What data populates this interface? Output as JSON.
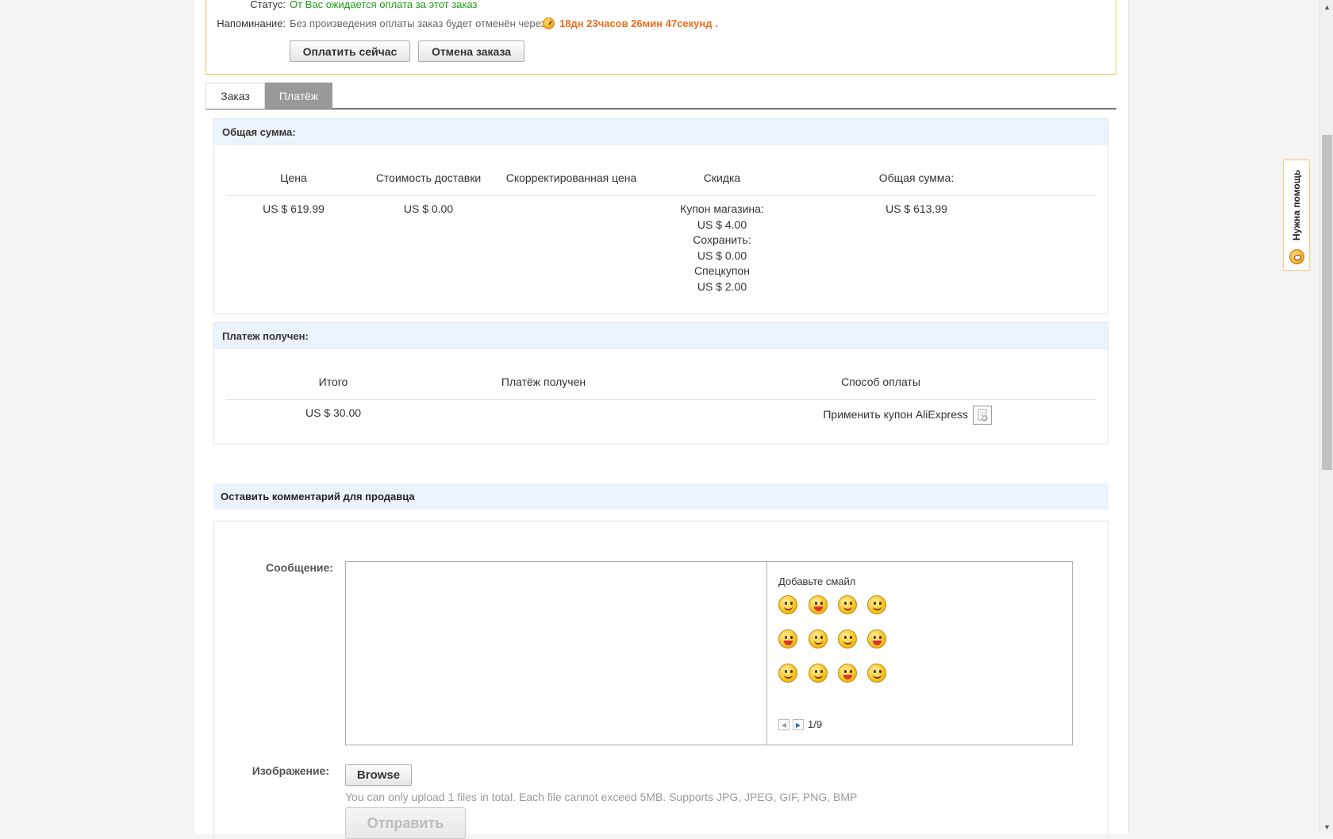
{
  "status_box": {
    "status_label": "Статус:",
    "status_value": "От Вас ожидается оплата за этот заказ",
    "reminder_label": "Напоминание:",
    "reminder_text": "Без произведения оплаты заказ будет отменён через:",
    "countdown": "18дн 23часов 26мин 47секунд .",
    "pay_now_label": "Оплатить сейчас",
    "cancel_label": "Отмена заказа"
  },
  "tabs": [
    {
      "label": "Заказ",
      "active": false
    },
    {
      "label": "Платёж",
      "active": true
    }
  ],
  "total_panel": {
    "title": "Общая сумма:",
    "columns": [
      "Цена",
      "Стоимость доставки",
      "Скорректированная цена",
      "Скидка",
      "Общая сумма:"
    ],
    "price": "US $ 619.99",
    "shipping": "US $ 0.00",
    "adjusted": "",
    "discount_lines": [
      "Купон магазина:",
      "US $ 4.00",
      "Сохранить:",
      "US $ 0.00",
      "Спецкупон",
      "US $ 2.00"
    ],
    "total": "US $ 613.99"
  },
  "payment_panel": {
    "title": "Платеж получен:",
    "columns": [
      "Итого",
      "Платёж получен",
      "Способ оплаты"
    ],
    "amount": "US $ 30.00",
    "received": "",
    "method": "Применить купон AliExpress"
  },
  "comment": {
    "header": "Оставить комментарий для продавца",
    "message_label": "Сообщение:",
    "message_value": "",
    "smiley_title": "Добавьте смайл",
    "pager": "1/9",
    "image_label": "Изображение:",
    "browse_label": "Browse",
    "upload_hint": "You can only upload 1 files in total. Each file cannot exceed 5MB. Supports JPG, JPEG, GIF, PNG, BMP",
    "submit_label": "Отправить"
  },
  "help_widget": {
    "label": "Нужна помощь"
  },
  "colors": {
    "status_green": "#1b9d14",
    "countdown_orange": "#f06b1c",
    "panel_header_bg": "#ebf3fd",
    "status_border": "#f0c552"
  }
}
